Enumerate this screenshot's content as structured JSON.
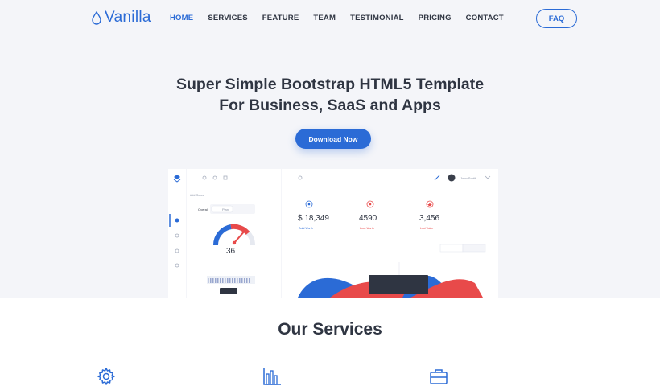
{
  "nav": {
    "logo": "Vanilla",
    "items": [
      {
        "label": "HOME",
        "active": true
      },
      {
        "label": "SERVICES"
      },
      {
        "label": "FEATURE"
      },
      {
        "label": "TEAM"
      },
      {
        "label": "TESTIMONIAL"
      },
      {
        "label": "PRICING"
      },
      {
        "label": "CONTACT"
      }
    ],
    "faq": "FAQ"
  },
  "hero": {
    "title_line1": "Super Simple Bootstrap HTML5 Template",
    "title_line2": "For Business, SaaS and Apps",
    "cta": "Download Now"
  },
  "dashboard": {
    "gauge_label": "### Score",
    "toggle_a": "Overall",
    "toggle_b": "Plan",
    "gauge_value": "36",
    "stats": [
      {
        "value": "$ 18,349",
        "sub": "Total Worth",
        "color": "#2b6bd6"
      },
      {
        "value": "4590",
        "sub": "Loss Worth",
        "color": "#e84a4a"
      },
      {
        "value": "3,456",
        "sub": "Lost Value",
        "color": "#e84a4a"
      }
    ],
    "user": "John Smith"
  },
  "services": {
    "title": "Our Services",
    "icons": [
      "gear-icon",
      "bar-chart-icon",
      "briefcase-icon"
    ]
  },
  "colors": {
    "primary": "#2b6bd6",
    "accent_red": "#e84a4a",
    "background": "#f4f5f9",
    "text": "#2f3542"
  }
}
